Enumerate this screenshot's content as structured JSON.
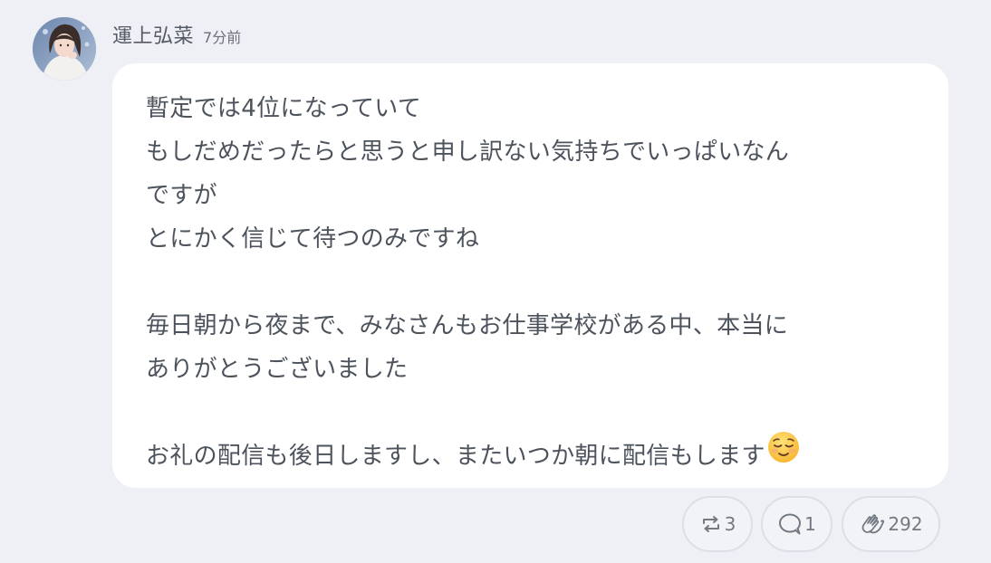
{
  "post": {
    "author": "運上弘菜",
    "time": "7分前",
    "lines": [
      "暫定では4位になっていて",
      "もしだめだったらと思うと申し訳ない気持ちでいっぱいなん",
      "ですが",
      "とにかく信じて待つのみですね",
      "",
      "毎日朝から夜まで、みなさんもお仕事学校がある中、本当に",
      "ありがとうございました",
      "",
      "お礼の配信も後日しますし、またいつか朝に配信もします"
    ],
    "end_emoji": "relieved-face-emoji"
  },
  "actions": {
    "repost_count": "3",
    "reply_count": "1",
    "clap_count": "292"
  },
  "colors": {
    "background": "#eef0f6",
    "bubble": "#ffffff",
    "text": "#4d535c",
    "pill_border": "#dcdfe5",
    "icon": "#737982"
  }
}
